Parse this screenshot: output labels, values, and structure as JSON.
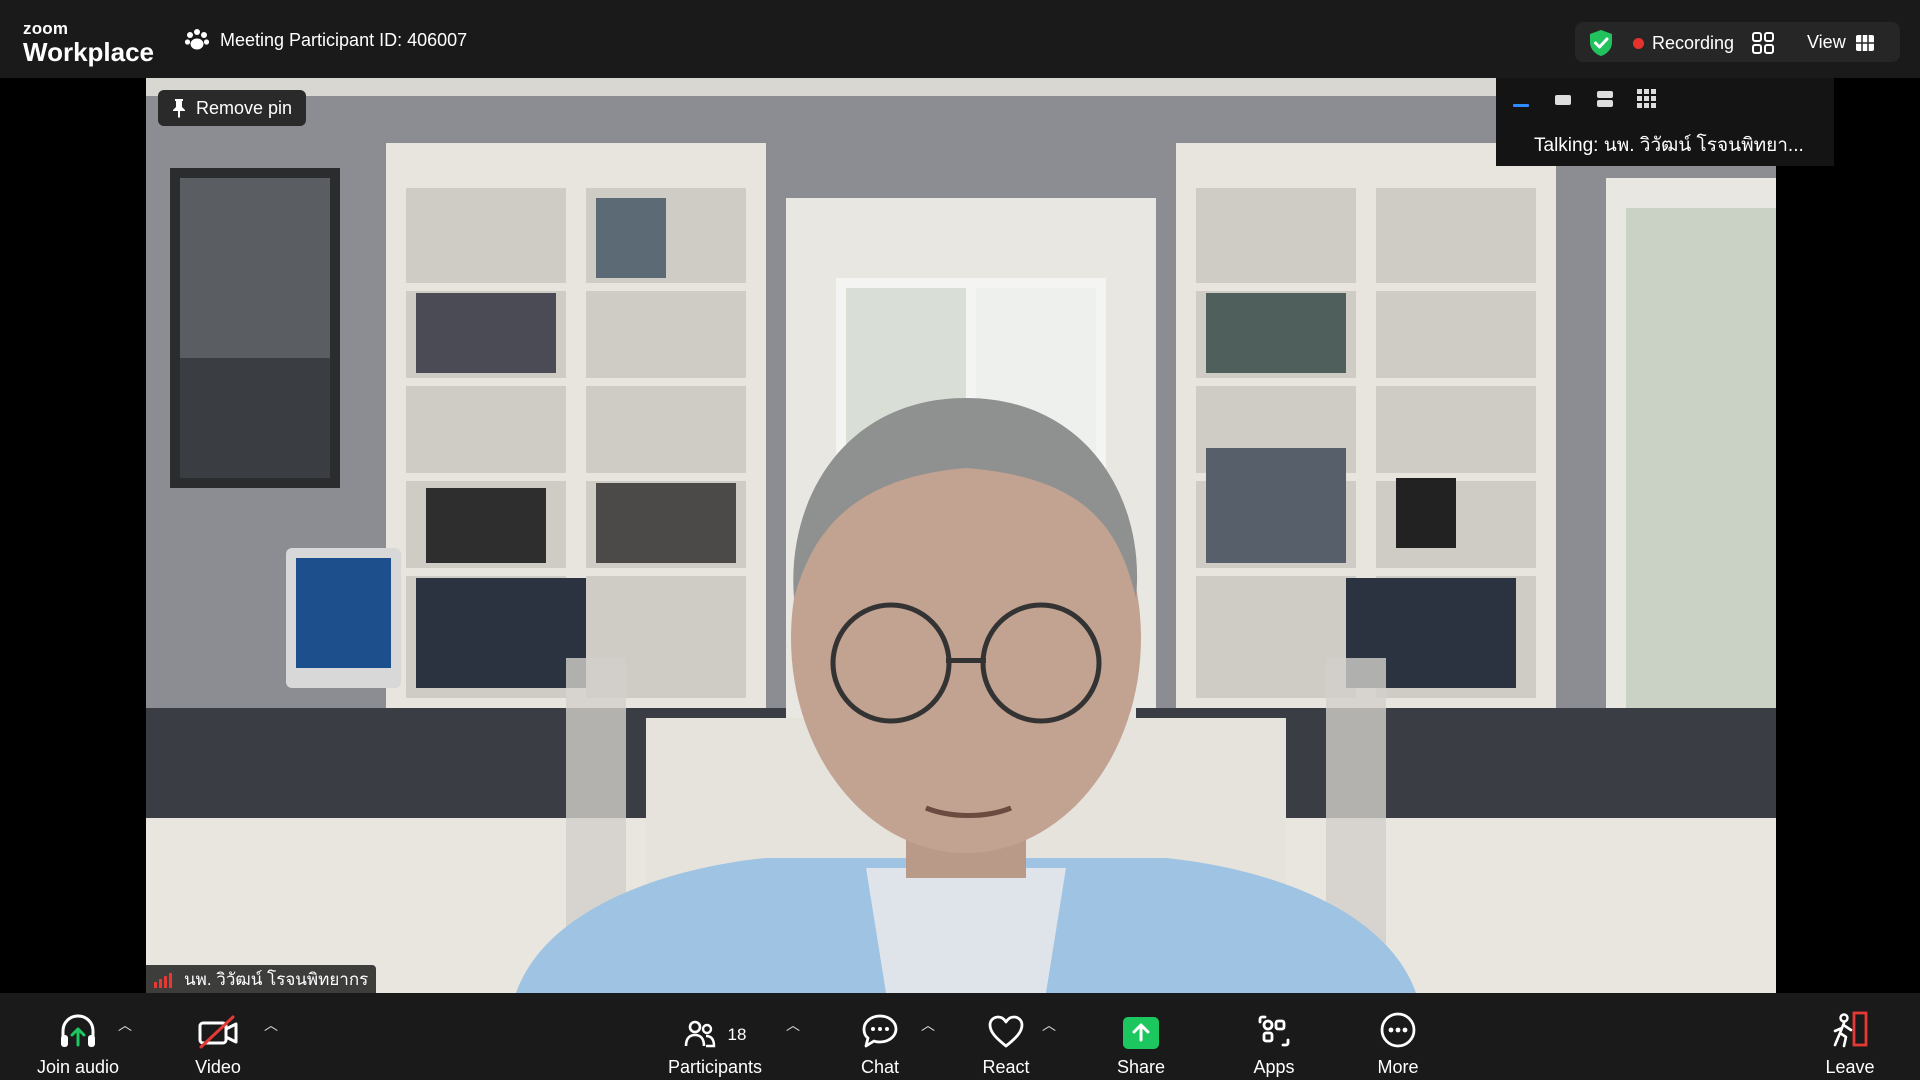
{
  "app": {
    "brand_small": "zoom",
    "brand_large": "Workplace"
  },
  "header": {
    "meeting_id": "Meeting Participant ID: 406007",
    "recording_label": "Recording",
    "view_label": "View"
  },
  "video": {
    "remove_pin_label": "Remove pin",
    "participant_name": "นพ. วิวัฒน์ โรจนพิทยากร"
  },
  "talking": {
    "text": "Talking: นพ. วิวัฒน์ โรจนพิทยา..."
  },
  "toolbar": {
    "join_audio": "Join audio",
    "video": "Video",
    "participants": "Participants",
    "participants_count": "18",
    "chat": "Chat",
    "react": "React",
    "share": "Share",
    "apps": "Apps",
    "more": "More",
    "leave": "Leave"
  },
  "colors": {
    "recording_dot": "#e5322d",
    "share_green": "#1cc760",
    "shield_green": "#22c35e",
    "leave_red": "#e53935"
  }
}
